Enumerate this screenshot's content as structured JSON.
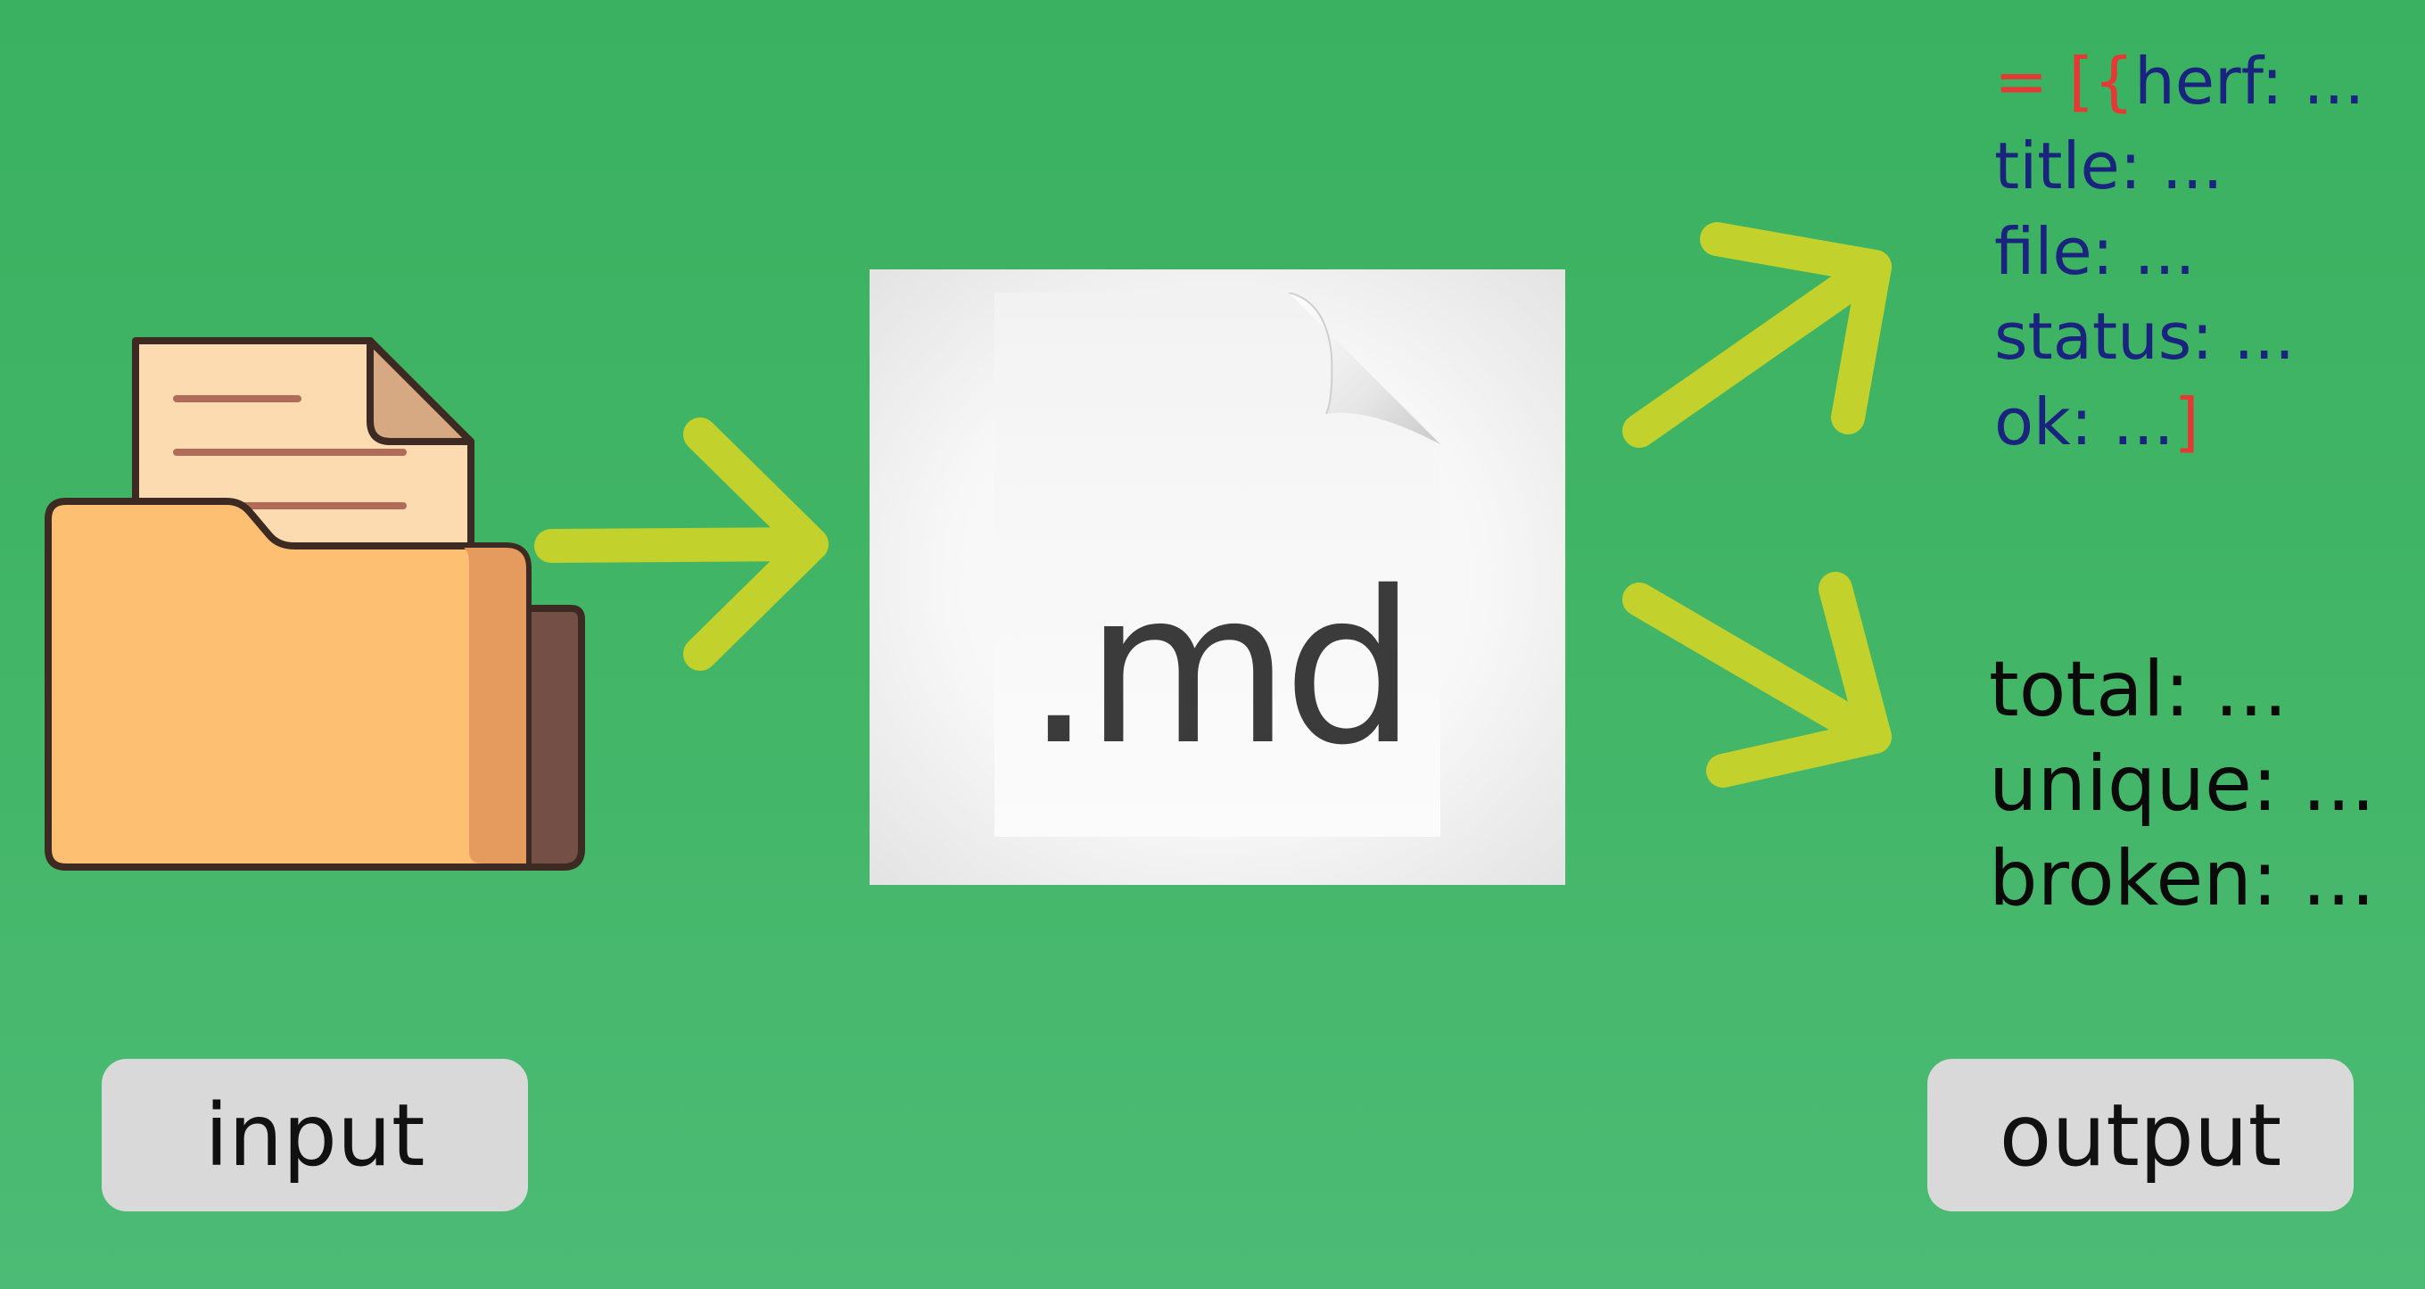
{
  "diagram": {
    "document": {
      "extension": ".md"
    },
    "output_array": {
      "open": "= [{",
      "fields": [
        "herf: ...",
        "title: ...",
        "file: ...",
        "status: ...",
        "ok: ..."
      ],
      "close": "]"
    },
    "output_stats": [
      "total: ...",
      "unique: ...",
      "broken: ..."
    ],
    "labels": {
      "input": "input",
      "output": "output"
    },
    "colors": {
      "background": "#42b566",
      "arrow": "#c2d12b",
      "code_text": "#1a237e",
      "bracket": "#e53935",
      "label_box": "#d9d9d9"
    }
  }
}
